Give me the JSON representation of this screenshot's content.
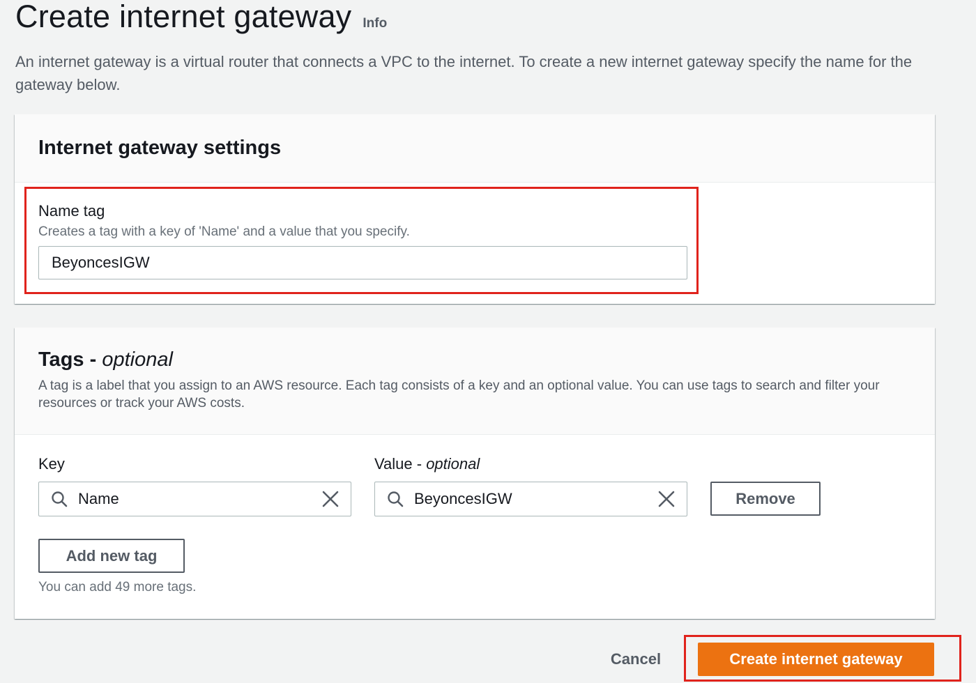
{
  "header": {
    "title": "Create internet gateway",
    "info_link": "Info",
    "description": "An internet gateway is a virtual router that connects a VPC to the internet. To create a new internet gateway specify the name for the gateway below."
  },
  "settings_panel": {
    "title": "Internet gateway settings",
    "name_tag": {
      "label": "Name tag",
      "description": "Creates a tag with a key of 'Name' and a value that you specify.",
      "value": "BeyoncesIGW"
    }
  },
  "tags_panel": {
    "title": "Tags - ",
    "title_optional": "optional",
    "description": "A tag is a label that you assign to an AWS resource. Each tag consists of a key and an optional value. You can use tags to search and filter your resources or track your AWS costs.",
    "key_label": "Key",
    "value_label": "Value - ",
    "value_label_optional": "optional",
    "tags": [
      {
        "key": "Name",
        "value": "BeyoncesIGW"
      }
    ],
    "remove_label": "Remove",
    "add_tag_label": "Add new tag",
    "limit_hint": "You can add 49 more tags."
  },
  "footer": {
    "cancel_label": "Cancel",
    "submit_label": "Create internet gateway"
  },
  "colors": {
    "primary": "#ec7211",
    "highlight": "#e0231c",
    "background": "#f2f3f3"
  },
  "icons": {
    "search": "search-icon",
    "clear": "close-icon"
  }
}
